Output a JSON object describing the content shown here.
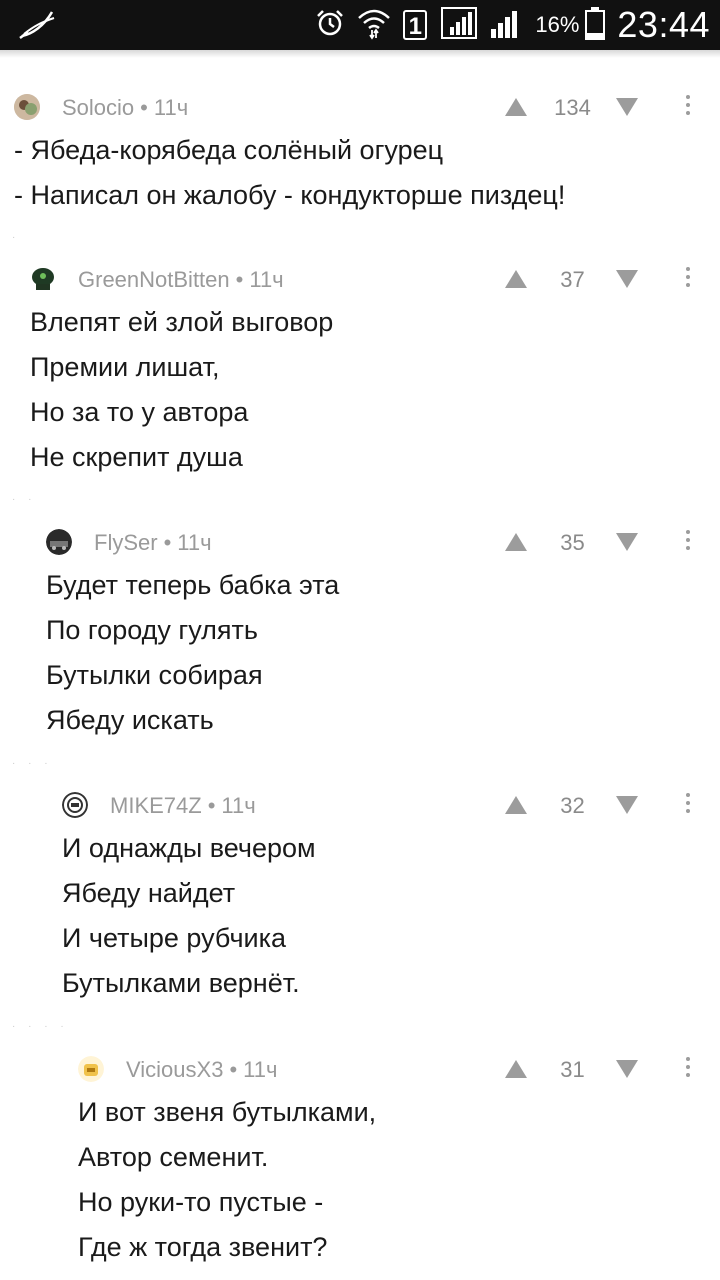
{
  "status_bar": {
    "left_icon": "feather-icon",
    "icons": [
      "alarm-clock-icon",
      "wifi-icon",
      "sim-badge-icon",
      "signal-icon",
      "signal-icon",
      "battery-icon"
    ],
    "sim_badge": "1",
    "battery_percent": "16%",
    "time": "23:44"
  },
  "comments": [
    {
      "author": "Solocio",
      "time": "11ч",
      "score": "134",
      "lines": [
        "- Ябеда-корябеда солёный огурец",
        "- Написал он жалобу - кондукторше пиздец!"
      ]
    },
    {
      "author": "GreenNotBitten",
      "time": "11ч",
      "score": "37",
      "lines": [
        "Влепят ей злой выговор",
        "Премии лишат,",
        "Но за то у автора",
        "Не скрепит душа"
      ]
    },
    {
      "author": "FlySer",
      "time": "11ч",
      "score": "35",
      "lines": [
        "Будет теперь бабка эта",
        "По городу гулять",
        "Бутылки собирая",
        "Ябеду искать"
      ]
    },
    {
      "author": "MIKE74Z",
      "time": "11ч",
      "score": "32",
      "lines": [
        "И однажды вечером",
        "Ябеду найдет",
        "И четыре рубчика",
        "Бутылками вернёт."
      ]
    },
    {
      "author": "ViciousX3",
      "time": "11ч",
      "score": "31",
      "lines": [
        "И вот звеня бутылками,",
        "Автор семенит.",
        "Но руки-то пустые -",
        "Где ж тогда звенит?"
      ]
    }
  ],
  "colors": {
    "status_bar_bg": "#111111",
    "meta_text": "#9a9a9a",
    "body_text": "#1a1a1a",
    "vote_icon": "#9c9c9c"
  }
}
